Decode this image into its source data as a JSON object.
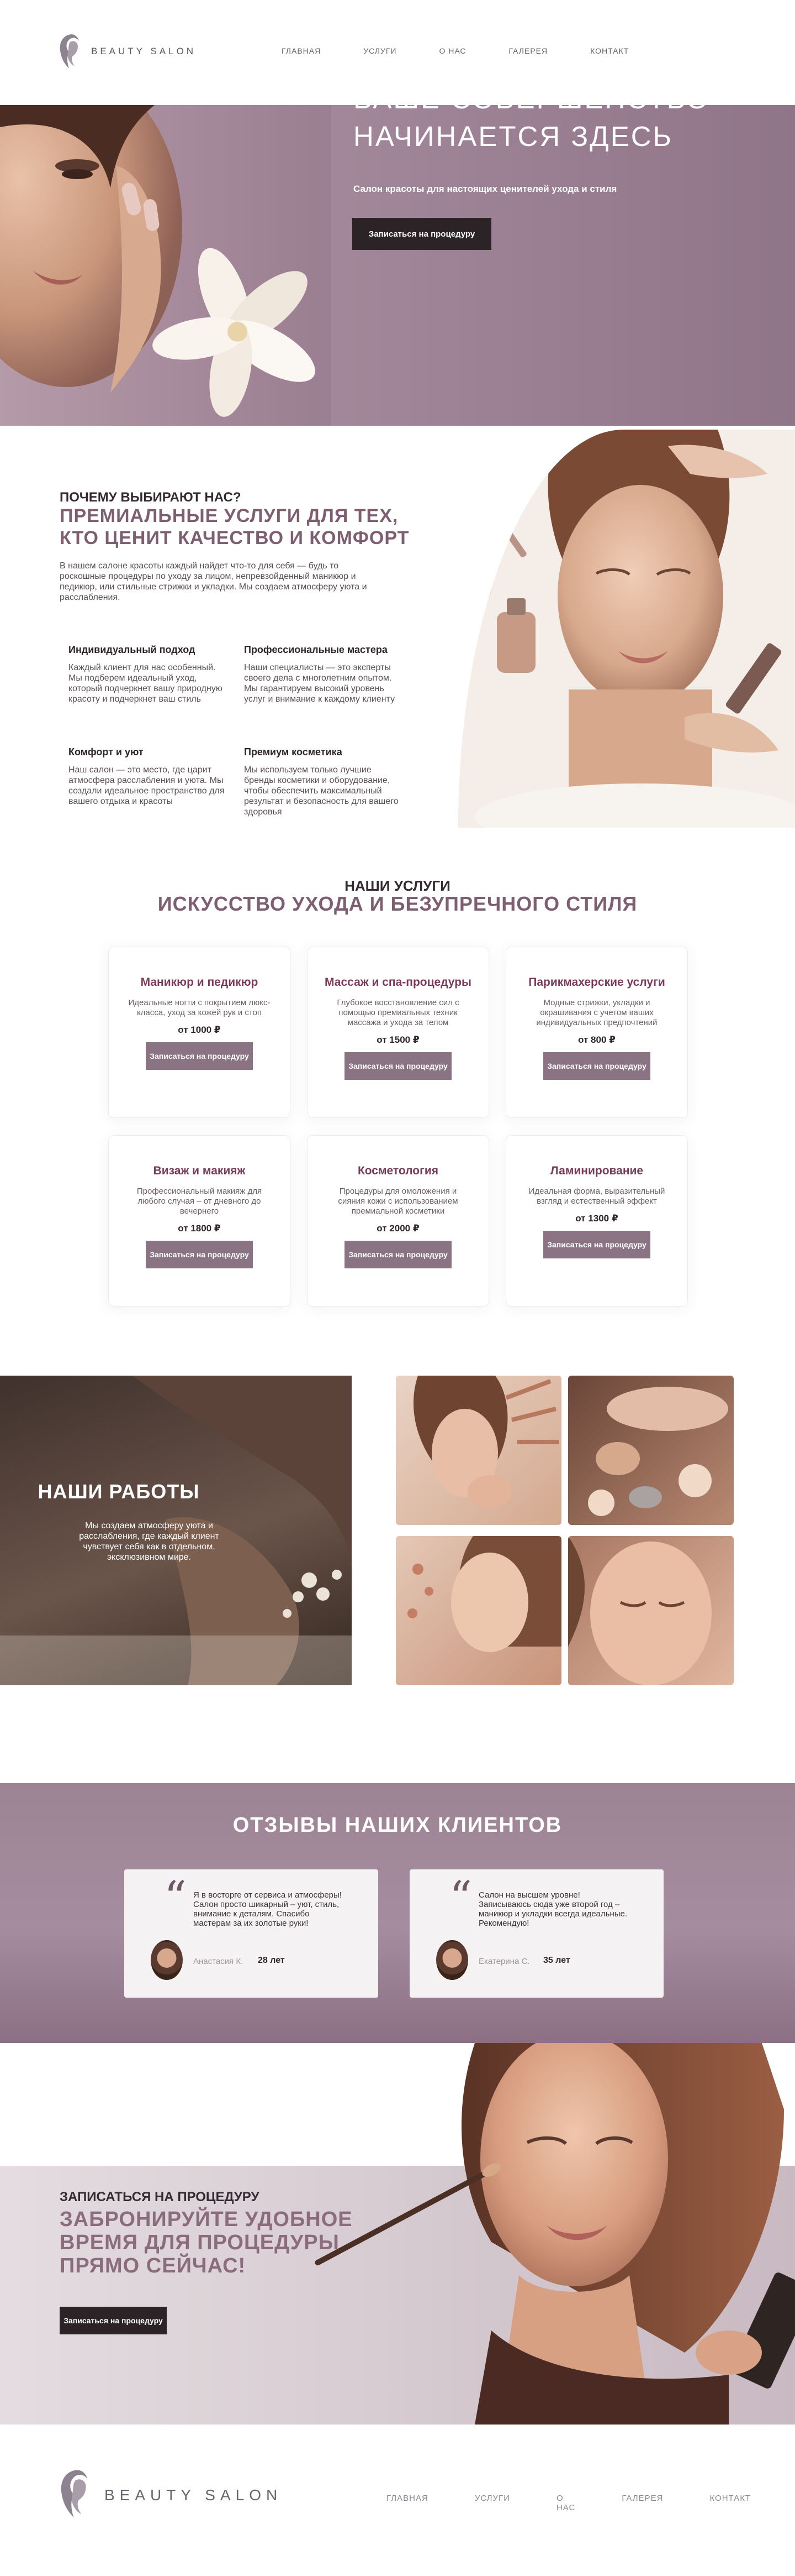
{
  "brand": {
    "name": "BEAUTY SALON"
  },
  "nav": [
    "ГЛАВНАЯ",
    "УСЛУГИ",
    "О НАС",
    "ГАЛЕРЕЯ",
    "КОНТАКТ"
  ],
  "hero": {
    "title_line1": "ВАШЕ СОВЕРШЕНСТВО",
    "title_line2": "НАЧИНАЕТСЯ ЗДЕСЬ",
    "subtitle": "Салон красоты для настоящих ценителей ухода и стиля",
    "button": "Записаться на процедуру"
  },
  "why": {
    "kicker": "ПОЧЕМУ ВЫБИРАЮТ НАС?",
    "title": "ПРЕМИАЛЬНЫЕ УСЛУГИ ДЛЯ ТЕХ, КТО ЦЕНИТ КАЧЕСТВО И КОМФОРТ",
    "text": "В нашем салоне красоты каждый найдет что-то для себя — будь то роскошные процедуры по уходу за лицом, непревзойденный маникюр и педикюр, или стильные стрижки и укладки. Мы создаем атмосферу уюта и расслабления.",
    "features": [
      {
        "title": "Индивидуальный подход",
        "text": "Каждый клиент для нас особенный. Мы подберем идеальный уход, который подчеркнет вашу природную красоту и подчеркнет ваш стиль"
      },
      {
        "title": "Профессиональные мастера",
        "text": "Наши специалисты — это эксперты своего дела с многолетним опытом. Мы гарантируем высокий уровень услуг и внимание к каждому клиенту"
      },
      {
        "title": "Комфорт и уют",
        "text": "Наш салон — это место, где царит атмосфера расслабления и уюта. Мы создали идеальное пространство для вашего отдыха и красоты"
      },
      {
        "title": "Премиум косметика",
        "text": "Мы используем только лучшие бренды косметики и оборудование, чтобы обеспечить максимальный результат и безопасность для вашего здоровья"
      }
    ]
  },
  "services": {
    "kicker": "НАШИ УСЛУГИ",
    "title": "ИСКУССТВО УХОДА И БЕЗУПРЕЧНОГО СТИЛЯ",
    "items": [
      {
        "title": "Маникюр и педикюр",
        "text": "Идеальные ногти с покрытием люкс-класса, уход за кожей рук и стоп",
        "price": "от 1000 ₽",
        "button": "Записаться на процедуру"
      },
      {
        "title": "Массаж и спа-процедуры",
        "text": "Глубокое восстановление сил с помощью премиальных техник массажа и ухода за телом",
        "price": "от 1500 ₽",
        "button": "Записаться на процедуру"
      },
      {
        "title": "Парикмахерские услуги",
        "text": "Модные стрижки, укладки и окрашивания с учетом ваших индивидуальных предпочтений",
        "price": "от 800 ₽",
        "button": "Записаться на процедуру"
      },
      {
        "title": "Визаж и макияж",
        "text": "Профессиональный макияж для любого случая – от дневного до вечернего",
        "price": "от 1800 ₽",
        "button": "Записаться на процедуру"
      },
      {
        "title": "Косметология",
        "text": "Процедуры для омоложения и сияния кожи с использованием премиальной косметики",
        "price": "от 2000 ₽",
        "button": "Записаться на процедуру"
      },
      {
        "title": "Ламинирование",
        "text": "Идеальная форма, выразительный взгляд и естественный эффект",
        "price": "от 1300 ₽",
        "button": "Записаться на процедуру"
      }
    ]
  },
  "works": {
    "title": "НАШИ РАБОТЫ",
    "text": "Мы создаем атмосферу уюта и расслабления, где каждый клиент чувствует себя как в отдельном, эксклюзивном мире."
  },
  "reviews": {
    "title": "ОТЗЫВЫ НАШИХ КЛИЕНТОВ",
    "items": [
      {
        "text": "Я в восторге от сервиса и атмосферы! Салон просто шикарный – уют, стиль, внимание к деталям. Спасибо мастерам за их золотые руки!",
        "name": "Анастасия К.",
        "age": "28 лет"
      },
      {
        "text": "Салон на высшем уровне! Записываюсь сюда уже второй год – маникюр и укладки всегда идеальные. Рекомендую!",
        "name": "Екатерина С.",
        "age": "35 лет"
      }
    ]
  },
  "booking": {
    "kicker": "ЗАПИСАТЬСЯ НА ПРОЦЕДУРУ",
    "title": "ЗАБРОНИРУЙТЕ УДОБНОЕ ВРЕМЯ ДЛЯ ПРОЦЕДУРЫ ПРЯМО СЕЙЧАС!",
    "button": "Записаться на процедуру"
  }
}
